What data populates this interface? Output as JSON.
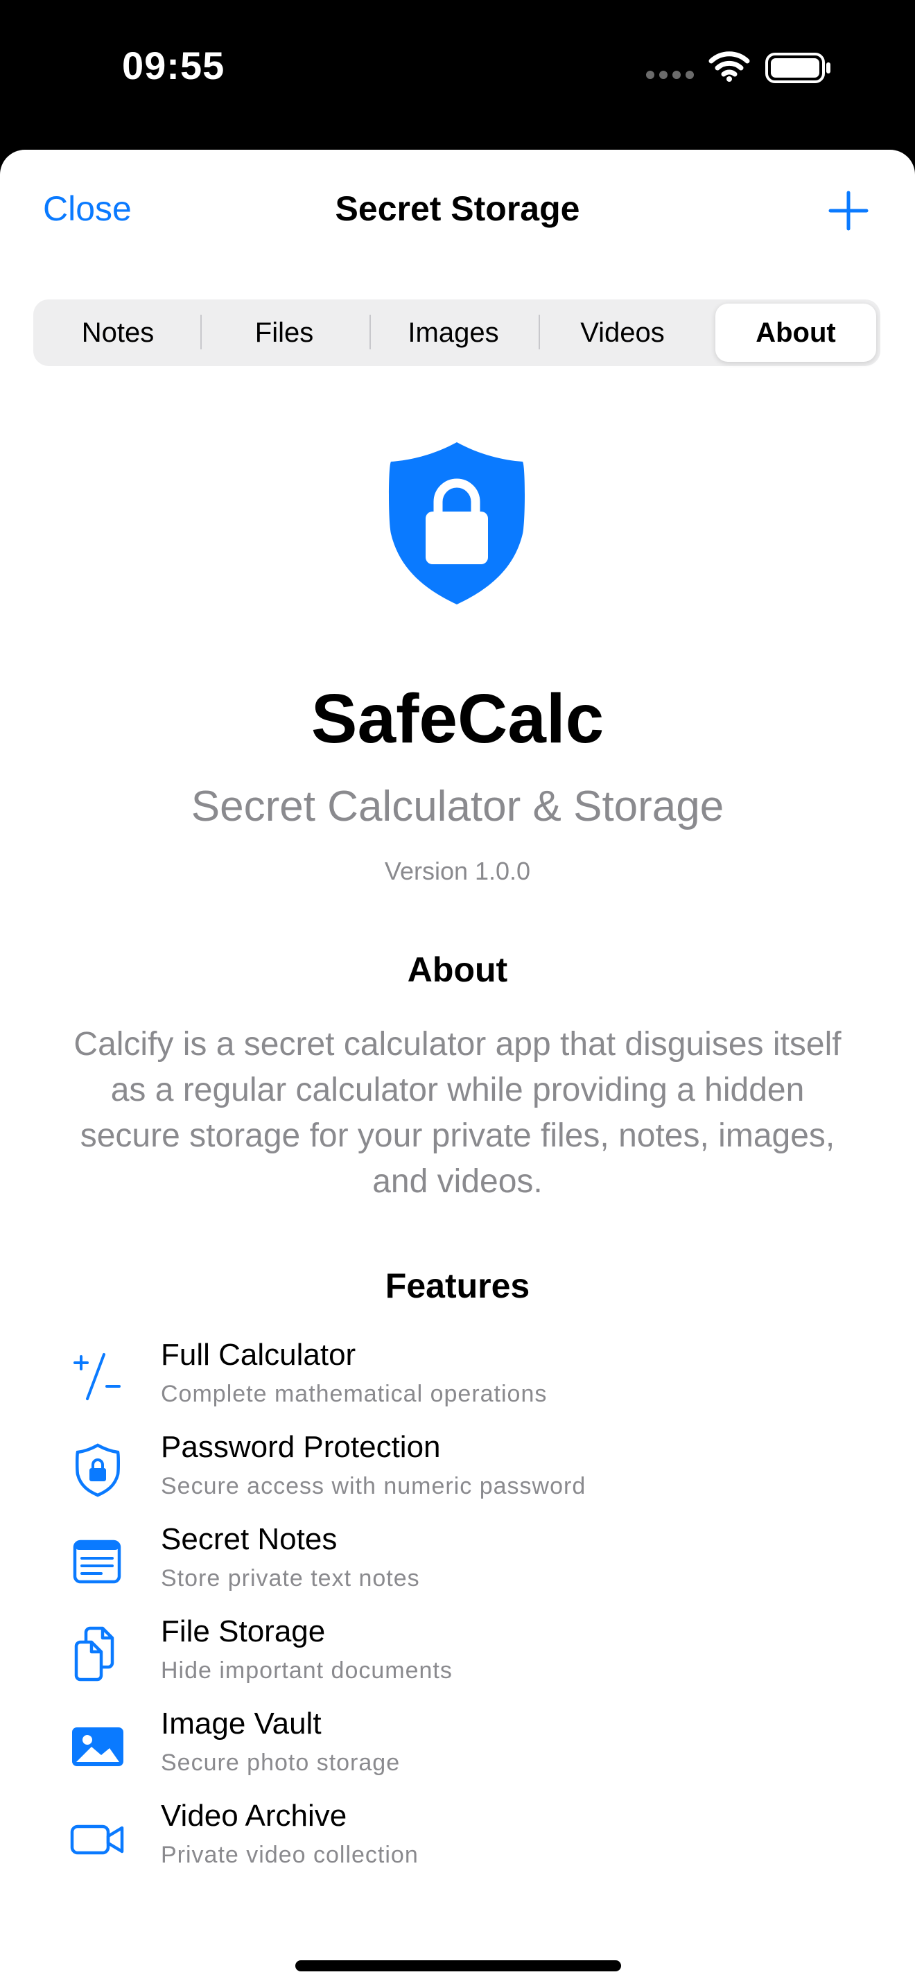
{
  "status_bar": {
    "time": "09:55",
    "icons": [
      "signal-dots-icon",
      "wifi-icon",
      "battery-icon"
    ]
  },
  "nav": {
    "close_label": "Close",
    "title": "Secret Storage",
    "add_icon": "plus-icon"
  },
  "tabs": [
    {
      "label": "Notes",
      "selected": false
    },
    {
      "label": "Files",
      "selected": false
    },
    {
      "label": "Images",
      "selected": false
    },
    {
      "label": "Videos",
      "selected": false
    },
    {
      "label": "About",
      "selected": true
    }
  ],
  "app": {
    "logo_icon": "shield-lock-icon",
    "name": "SafeCalc",
    "subtitle": "Secret Calculator & Storage",
    "version": "Version 1.0.0"
  },
  "about": {
    "heading": "About",
    "text": "Calcify is a secret calculator app that disguises itself as a regular calculator while providing a hidden secure storage for your private files, notes, images, and videos."
  },
  "features": {
    "heading": "Features",
    "items": [
      {
        "icon": "plus-minus-icon",
        "title": "Full Calculator",
        "description": "Complete mathematical operations"
      },
      {
        "icon": "lock-shield-icon",
        "title": "Password Protection",
        "description": "Secure access with numeric password"
      },
      {
        "icon": "note-text-icon",
        "title": "Secret Notes",
        "description": "Store private text notes"
      },
      {
        "icon": "documents-icon",
        "title": "File Storage",
        "description": "Hide important documents"
      },
      {
        "icon": "photo-icon",
        "title": "Image Vault",
        "description": "Secure photo storage"
      },
      {
        "icon": "video-camera-icon",
        "title": "Video Archive",
        "description": "Private video collection"
      }
    ]
  },
  "colors": {
    "accent": "#0a7aff",
    "secondary_text": "#8a8a8e",
    "segment_bg": "#eeeeef"
  }
}
